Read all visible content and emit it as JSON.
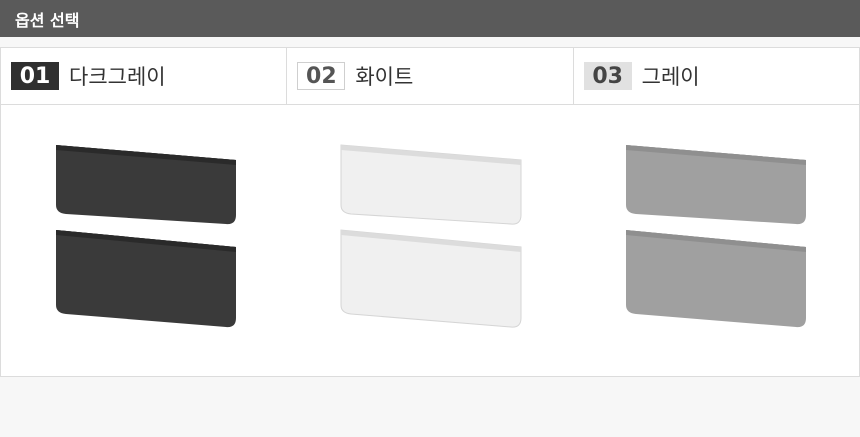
{
  "header": {
    "title": "옵션 선택"
  },
  "options": [
    {
      "number": "01",
      "label": "다크그레이",
      "color": "#3a3a3a",
      "shade": "#2a2a2a",
      "inner": "#262626"
    },
    {
      "number": "02",
      "label": "화이트",
      "color": "#efefef",
      "shade": "#dcdcdc",
      "inner": "#e6e6e6"
    },
    {
      "number": "03",
      "label": "그레이",
      "color": "#a0a0a0",
      "shade": "#8f8f8f",
      "inner": "#8a8a8a"
    }
  ]
}
